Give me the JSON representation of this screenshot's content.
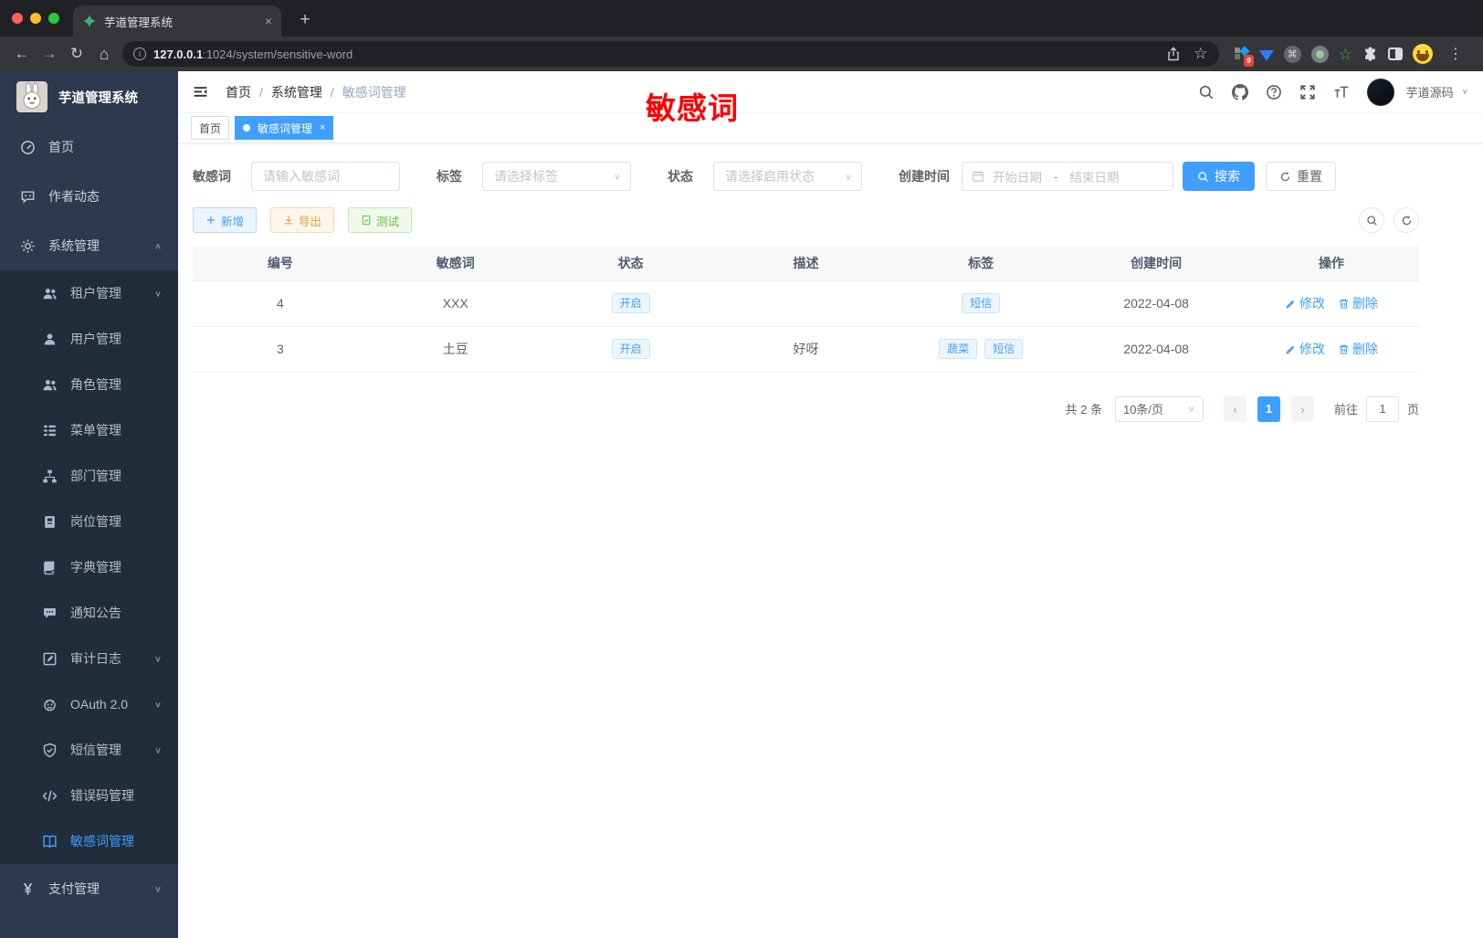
{
  "browser": {
    "tab_title": "芋道管理系统",
    "url_host": "127.0.0.1",
    "url_path": ":1024/system/sensitive-word",
    "extension_badge": "9"
  },
  "sidebar": {
    "logo_title": "芋道管理系统",
    "items": [
      {
        "name": "home",
        "label": "首页",
        "icon": "dashboard-icon"
      },
      {
        "name": "author-news",
        "label": "作者动态",
        "icon": "message-icon"
      },
      {
        "name": "system-management",
        "label": "系统管理",
        "icon": "gear-icon",
        "arrow": "up"
      },
      {
        "name": "tenant-management",
        "label": "租户管理",
        "icon": "tenant-users-icon",
        "sub": true,
        "arrow": "down"
      },
      {
        "name": "user-management",
        "label": "用户管理",
        "icon": "user-icon",
        "sub": true
      },
      {
        "name": "role-management",
        "label": "角色管理",
        "icon": "role-users-icon",
        "sub": true
      },
      {
        "name": "menu-management",
        "label": "菜单管理",
        "icon": "menu-list-icon",
        "sub": true
      },
      {
        "name": "dept-management",
        "label": "部门管理",
        "icon": "org-tree-icon",
        "sub": true
      },
      {
        "name": "post-management",
        "label": "岗位管理",
        "icon": "post-badge-icon",
        "sub": true
      },
      {
        "name": "dict-management",
        "label": "字典管理",
        "icon": "dict-book-icon",
        "sub": true
      },
      {
        "name": "notice",
        "label": "通知公告",
        "icon": "notice-bubble-icon",
        "sub": true
      },
      {
        "name": "audit-log",
        "label": "审计日志",
        "icon": "log-edit-icon",
        "sub": true,
        "arrow": "down"
      },
      {
        "name": "oauth2",
        "label": "OAuth 2.0",
        "icon": "oauth-robot-icon",
        "sub": true,
        "arrow": "down"
      },
      {
        "name": "sms-management",
        "label": "短信管理",
        "icon": "shield-check-icon",
        "sub": true,
        "arrow": "down"
      },
      {
        "name": "error-code-management",
        "label": "错误码管理",
        "icon": "code-icon",
        "sub": true
      },
      {
        "name": "sensitive-word-management",
        "label": "敏感词管理",
        "icon": "open-book-icon",
        "sub": true,
        "active": true
      },
      {
        "name": "pay-management",
        "label": "支付管理",
        "icon": "yen-icon",
        "arrow": "down"
      }
    ]
  },
  "header": {
    "breadcrumb": [
      "首页",
      "系统管理",
      "敏感词管理"
    ],
    "annotation": "敏感词",
    "username": "芋道源码"
  },
  "tags": [
    {
      "label": "首页",
      "active": false,
      "closable": false
    },
    {
      "label": "敏感词管理",
      "active": true,
      "closable": true
    }
  ],
  "filters": {
    "keyword_label": "敏感词",
    "keyword_placeholder": "请输入敏感词",
    "tag_label": "标签",
    "tag_placeholder": "请选择标签",
    "status_label": "状态",
    "status_placeholder": "请选择启用状态",
    "date_label": "创建时间",
    "date_start_placeholder": "开始日期",
    "date_separator": "-",
    "date_end_placeholder": "结束日期",
    "search_label": "搜索",
    "reset_label": "重置"
  },
  "toolbar": {
    "add_label": "新增",
    "export_label": "导出",
    "test_label": "测试"
  },
  "table": {
    "headers": [
      "编号",
      "敏感词",
      "状态",
      "描述",
      "标签",
      "创建时间",
      "操作"
    ],
    "rows": [
      {
        "id": "4",
        "word": "XXX",
        "status": "开启",
        "description": "",
        "tags": [
          "短信"
        ],
        "created": "2022-04-08"
      },
      {
        "id": "3",
        "word": "土豆",
        "status": "开启",
        "description": "好呀",
        "tags": [
          "蔬菜",
          "短信"
        ],
        "created": "2022-04-08"
      }
    ],
    "edit_label": "修改",
    "delete_label": "删除"
  },
  "pagination": {
    "total": "共 2 条",
    "page_size": "10条/页",
    "current_page": "1",
    "goto_label": "前往",
    "goto_value": "1",
    "page_unit": "页"
  },
  "colors": {
    "primary": "#409eff",
    "success": "#67c23a",
    "warning": "#e6a23c",
    "annotation_red": "#ff0000",
    "sidebar_bg": "#2d3a4e",
    "submenu_bg": "#222d3c"
  }
}
